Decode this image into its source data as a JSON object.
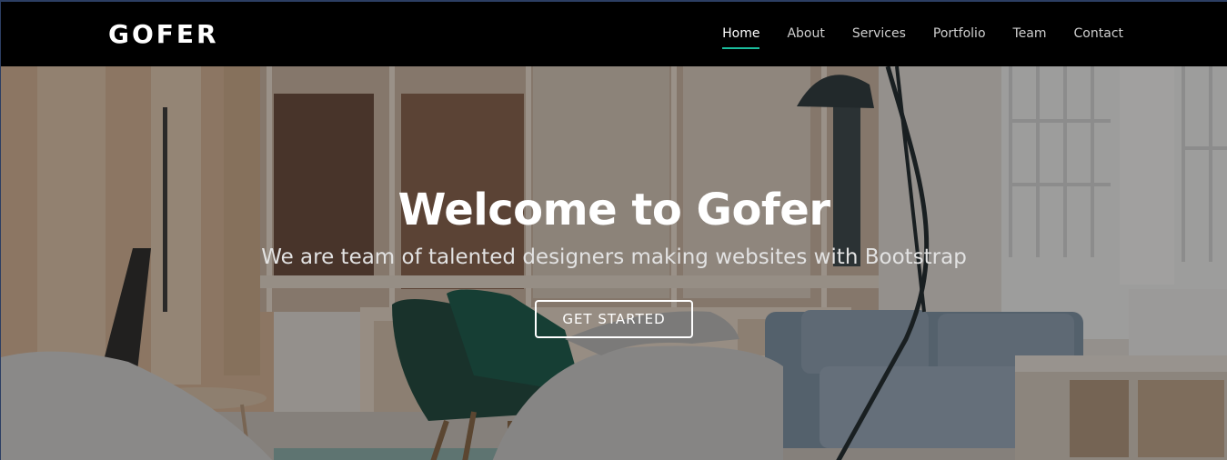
{
  "brand": {
    "name": "GOFER"
  },
  "nav": {
    "items": [
      {
        "label": "Home",
        "active": true
      },
      {
        "label": "About"
      },
      {
        "label": "Services"
      },
      {
        "label": "Portfolio"
      },
      {
        "label": "Team"
      },
      {
        "label": "Contact"
      }
    ],
    "accent_color": "#1abc9c"
  },
  "hero": {
    "title": "Welcome to Gofer",
    "subtitle": "We are team of talented designers making websites with Bootstrap",
    "cta_label": "GET STARTED"
  }
}
